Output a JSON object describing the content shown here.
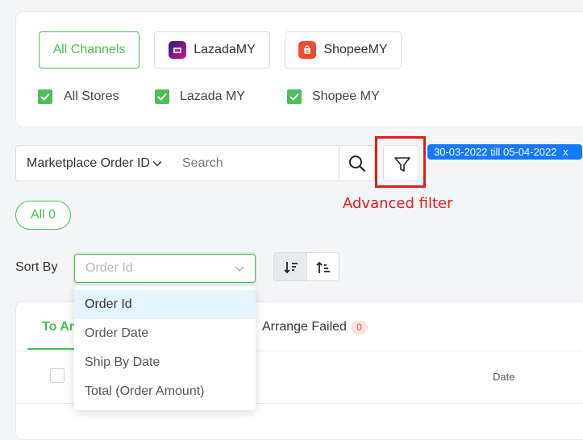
{
  "channels": {
    "all_label": "All Channels",
    "lazada_label": "LazadaMY",
    "shopee_label": "ShopeeMY"
  },
  "stores": {
    "all": "All Stores",
    "lazada": "Lazada MY",
    "shopee": "Shopee MY"
  },
  "search": {
    "field_selected": "Marketplace Order ID",
    "placeholder": "Search"
  },
  "date_chip": {
    "label": "30-03-2022 till 05-04-2022",
    "close": "x"
  },
  "annotation": {
    "label": "Advanced filter"
  },
  "status_pill": {
    "label": "All 0"
  },
  "sort": {
    "label": "Sort By",
    "placeholder": "Order Id",
    "options": [
      "Order Id",
      "Order Date",
      "Ship By Date",
      "Total (Order Amount)"
    ]
  },
  "tabs": {
    "active_partial": "To Arr",
    "arrange_failed": "Arrange Failed",
    "arrange_failed_count": "0"
  },
  "table": {
    "date_header": "Date"
  },
  "colors": {
    "accent": "#4cbe57",
    "chip": "#1677ff",
    "highlight": "#e21b1b"
  }
}
